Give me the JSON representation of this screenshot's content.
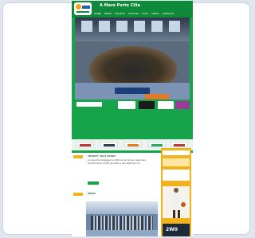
{
  "site": {
    "title": "A Mare Porto Cilia",
    "nav": [
      "HOME",
      "NEWS",
      "SOCIETA",
      "SETTORI",
      "FOTO",
      "VIDEO",
      "CONTATTI"
    ]
  },
  "hero": {
    "caption": ""
  },
  "posts": [
    {
      "title": "TROPHY 2024 SPORT",
      "text": "La squadra festeggia la vittoria del torneo regionale. Complimenti a tutti gli atleti e allo staff tecnico."
    },
    {
      "title": "NEWS",
      "text": ""
    }
  ],
  "sidebar": {
    "badge": "2W0"
  },
  "colors": {
    "header": "#0f8a3a",
    "band": "#16a34a",
    "sidebar": "#f2b21a"
  }
}
